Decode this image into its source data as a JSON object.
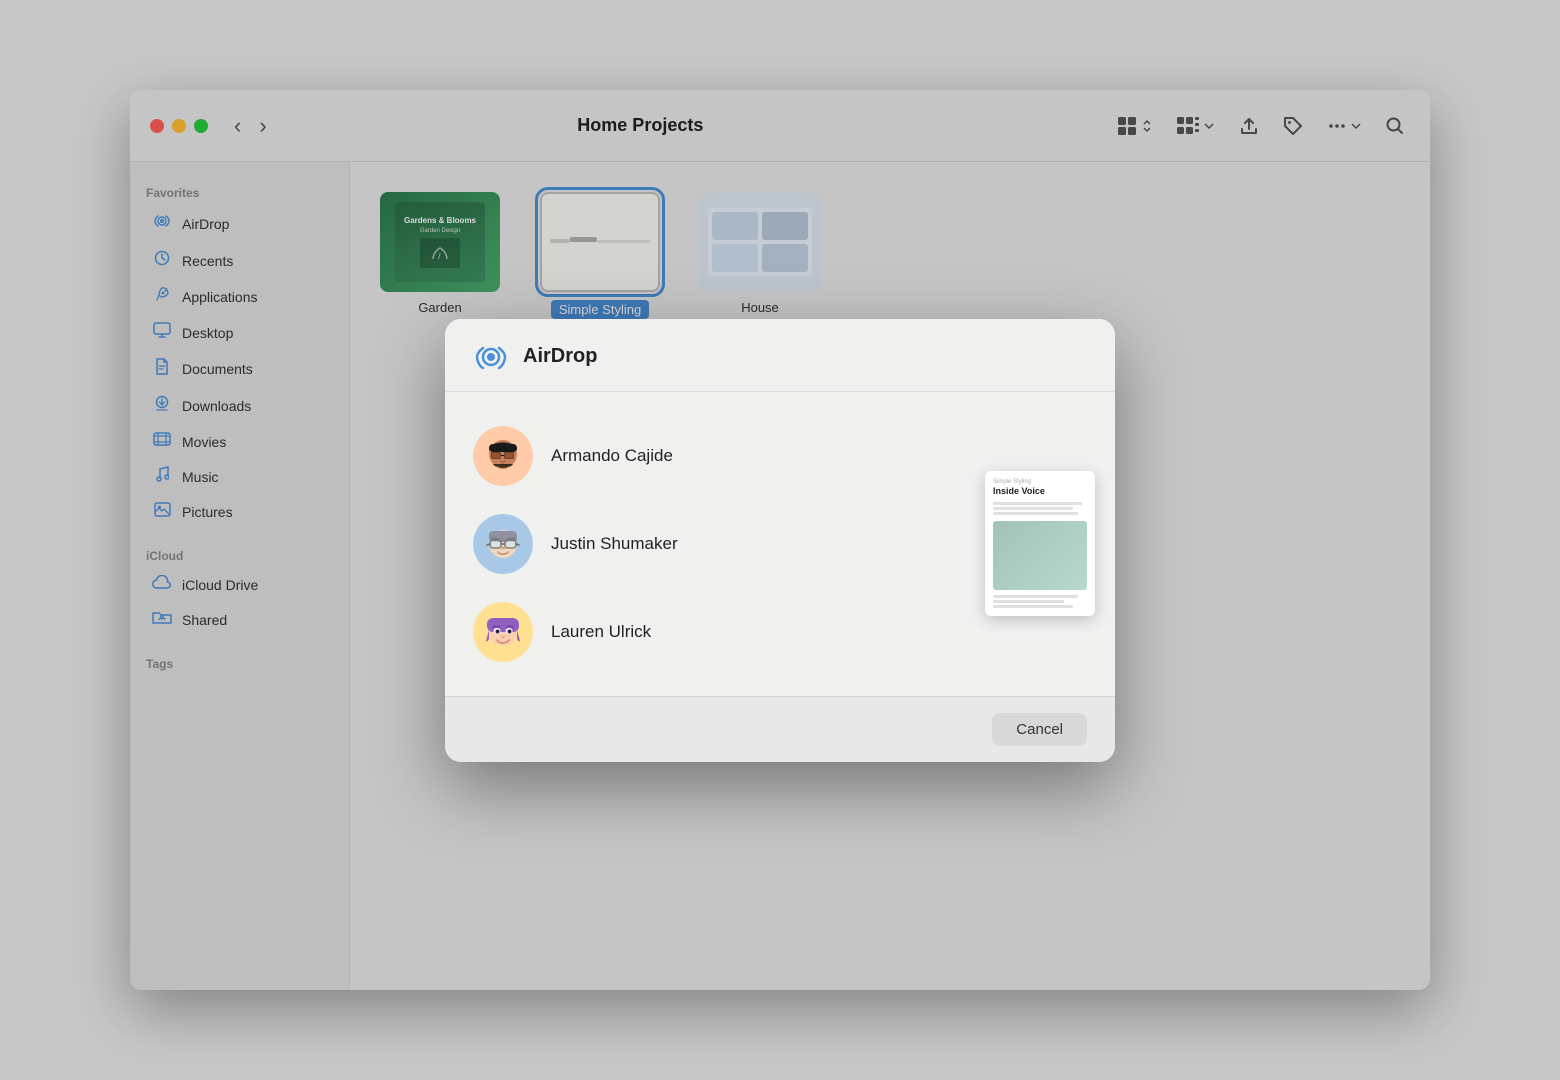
{
  "window": {
    "title": "Home Projects"
  },
  "sidebar": {
    "favorites_label": "Favorites",
    "icloud_label": "iCloud",
    "tags_label": "Tags",
    "items": [
      {
        "id": "airdrop",
        "label": "AirDrop",
        "icon": "airdrop"
      },
      {
        "id": "recents",
        "label": "Recents",
        "icon": "clock"
      },
      {
        "id": "applications",
        "label": "Applications",
        "icon": "rocket"
      },
      {
        "id": "desktop",
        "label": "Desktop",
        "icon": "desktop"
      },
      {
        "id": "documents",
        "label": "Documents",
        "icon": "doc"
      },
      {
        "id": "downloads",
        "label": "Downloads",
        "icon": "download"
      },
      {
        "id": "movies",
        "label": "Movies",
        "icon": "film"
      },
      {
        "id": "music",
        "label": "Music",
        "icon": "music"
      },
      {
        "id": "pictures",
        "label": "Pictures",
        "icon": "photo"
      }
    ],
    "icloud_items": [
      {
        "id": "icloud-drive",
        "label": "iCloud Drive",
        "icon": "cloud"
      },
      {
        "id": "shared",
        "label": "Shared",
        "icon": "folder-shared"
      }
    ]
  },
  "files": [
    {
      "id": "garden",
      "name": "Garden",
      "selected": false
    },
    {
      "id": "simple-styling",
      "name": "Simple Styling",
      "selected": true
    },
    {
      "id": "house",
      "name": "House",
      "selected": false
    }
  ],
  "airdrop_modal": {
    "title": "AirDrop",
    "contacts": [
      {
        "id": "armando",
        "name": "Armando Cajide"
      },
      {
        "id": "justin",
        "name": "Justin Shumaker"
      },
      {
        "id": "lauren",
        "name": "Lauren Ulrick"
      }
    ],
    "preview": {
      "subtitle": "Simple Styling",
      "title": "Inside Voice",
      "text_lines": 3
    },
    "cancel_label": "Cancel"
  },
  "toolbar": {
    "back_label": "‹",
    "forward_label": "›"
  }
}
